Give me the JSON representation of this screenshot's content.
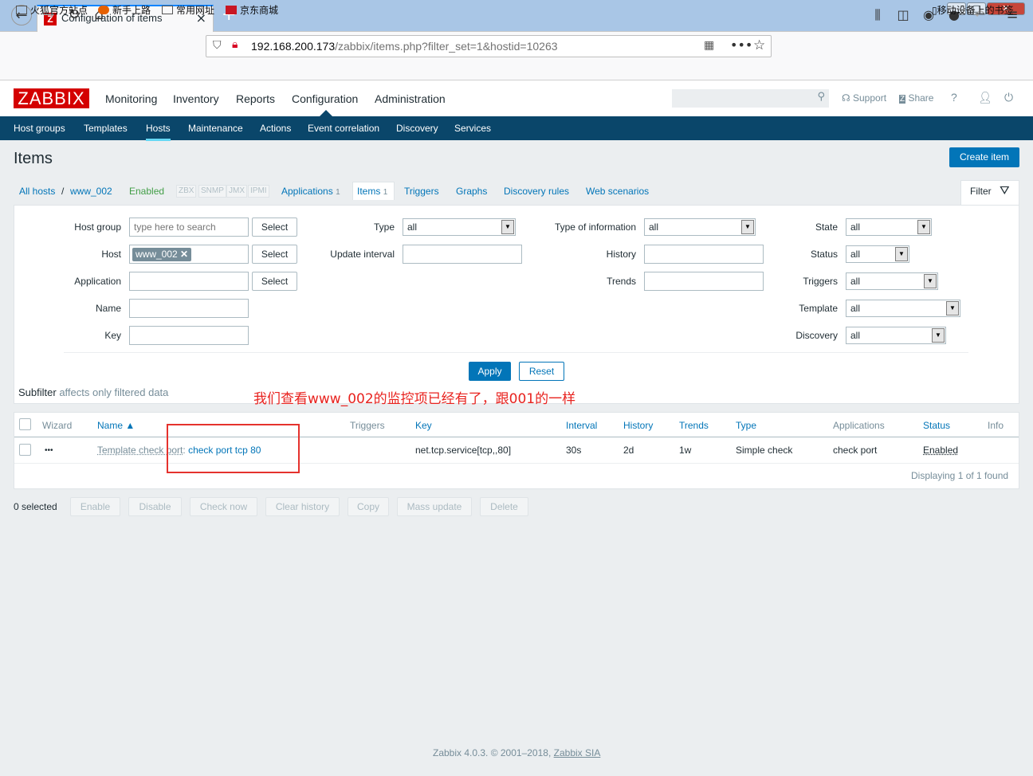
{
  "browser": {
    "tab_title": "Configuration of items",
    "tab_favicon": "Z",
    "url_host": "192.168.200.173",
    "url_path": "/zabbix/items.php?filter_set=1&hostid=10263",
    "bookmarks": [
      "火狐官方站点",
      "新手上路",
      "常用网址",
      "京东商城"
    ],
    "mobile_bookmarks": "移动设备上的书签"
  },
  "zabbix": {
    "logo": "ZABBIX",
    "menu": [
      "Monitoring",
      "Inventory",
      "Reports",
      "Configuration",
      "Administration"
    ],
    "support": "Support",
    "share": "Share",
    "help": "?",
    "submenu": [
      "Host groups",
      "Templates",
      "Hosts",
      "Maintenance",
      "Actions",
      "Event correlation",
      "Discovery",
      "Services"
    ]
  },
  "page": {
    "title": "Items",
    "create_button": "Create item",
    "breadcrumb": {
      "all_hosts": "All hosts",
      "sep": "/",
      "host": "www_002",
      "status": "Enabled",
      "tags": [
        "ZBX",
        "SNMP",
        "JMX",
        "IPMI"
      ],
      "applications": "Applications",
      "applications_count": "1",
      "items": "Items",
      "items_count": "1",
      "triggers": "Triggers",
      "graphs": "Graphs",
      "discovery_rules": "Discovery rules",
      "web_scenarios": "Web scenarios"
    },
    "filter_tab": "Filter"
  },
  "filter": {
    "host_group_label": "Host group",
    "host_group_placeholder": "type here to search",
    "select_label": "Select",
    "host_label": "Host",
    "host_chip": "www_002",
    "application_label": "Application",
    "name_label": "Name",
    "key_label": "Key",
    "type_label": "Type",
    "type_value": "all",
    "update_interval_label": "Update interval",
    "type_info_label": "Type of information",
    "type_info_value": "all",
    "history_label": "History",
    "trends_label": "Trends",
    "state_label": "State",
    "state_value": "all",
    "status_label": "Status",
    "status_value": "all",
    "triggers_label": "Triggers",
    "triggers_value": "all",
    "template_label": "Template",
    "template_value": "all",
    "discovery_label": "Discovery",
    "discovery_value": "all",
    "apply": "Apply",
    "reset": "Reset"
  },
  "subfilter": {
    "label": "Subfilter",
    "note": "affects only filtered data"
  },
  "annotation": "我们查看www_002的监控项已经有了，跟001的一样",
  "table": {
    "headers": {
      "wizard": "Wizard",
      "name": "Name ▲",
      "triggers": "Triggers",
      "key": "Key",
      "interval": "Interval",
      "history": "History",
      "trends": "Trends",
      "type": "Type",
      "applications": "Applications",
      "status": "Status",
      "info": "Info"
    },
    "row": {
      "wizard": "•••",
      "template_prefix": "Template check port",
      "name": "check port tcp 80",
      "key": "net.tcp.service[tcp,,80]",
      "interval": "30s",
      "history": "2d",
      "trends": "1w",
      "type": "Simple check",
      "applications": "check port",
      "status": "Enabled"
    },
    "displaying": "Displaying 1 of 1 found"
  },
  "actions": {
    "selected": "0 selected",
    "buttons": [
      "Enable",
      "Disable",
      "Check now",
      "Clear history",
      "Copy",
      "Mass update",
      "Delete"
    ]
  },
  "footer": {
    "text": "Zabbix 4.0.3. © 2001–2018,",
    "link": "Zabbix SIA"
  }
}
